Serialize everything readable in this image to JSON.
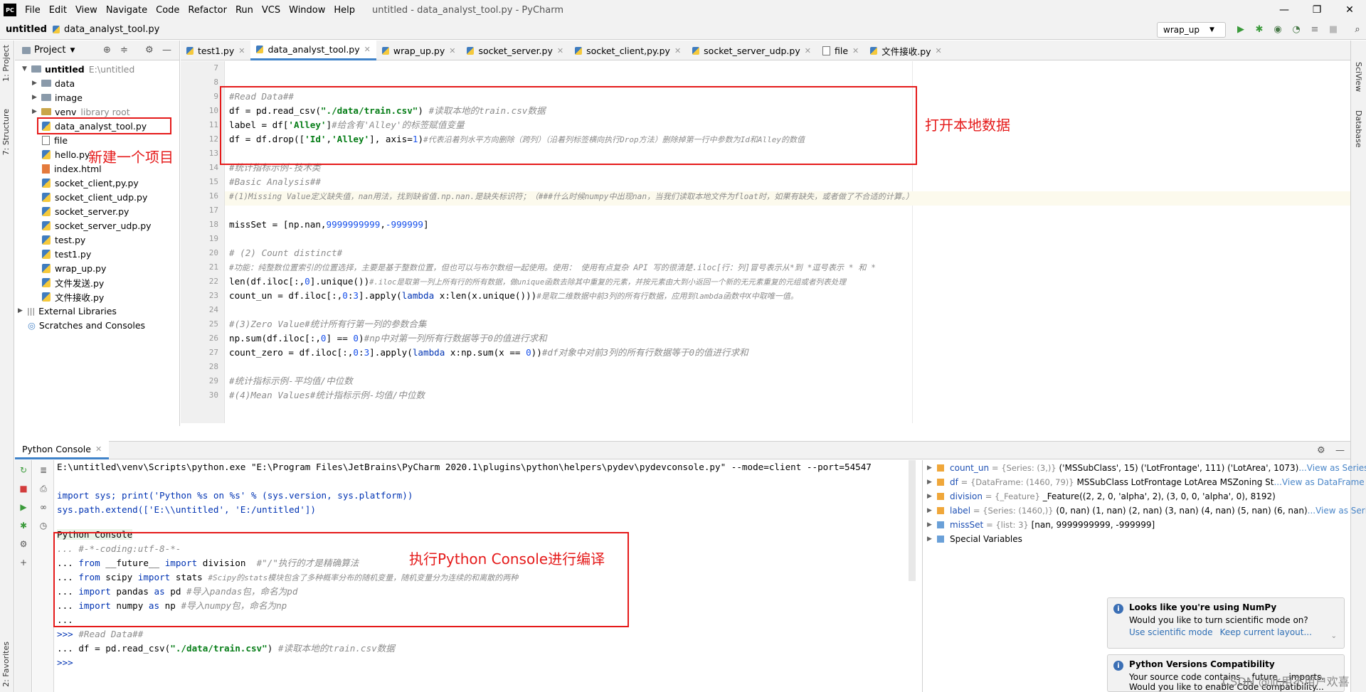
{
  "window": {
    "title": "untitled - data_analyst_tool.py - PyCharm",
    "logo": "PC"
  },
  "menu": [
    "File",
    "Edit",
    "View",
    "Navigate",
    "Code",
    "Refactor",
    "Run",
    "VCS",
    "Window",
    "Help"
  ],
  "window_buttons": [
    "—",
    "❐",
    "✕"
  ],
  "breadcrumb": [
    "untitled",
    "data_analyst_tool.py"
  ],
  "run_config": "wrap_up",
  "project": {
    "header": "Project",
    "root": "untitled",
    "root_path": "E:\\untitled",
    "items": [
      {
        "label": "data",
        "kind": "folder",
        "extra": ""
      },
      {
        "label": "image",
        "kind": "folder",
        "extra": ""
      },
      {
        "label": "venv",
        "kind": "folder",
        "extra": "library root"
      },
      {
        "label": "data_analyst_tool.py",
        "kind": "py",
        "extra": ""
      },
      {
        "label": "file",
        "kind": "file",
        "extra": ""
      },
      {
        "label": "hello.py",
        "kind": "py",
        "extra": ""
      },
      {
        "label": "index.html",
        "kind": "html",
        "extra": ""
      },
      {
        "label": "socket_client,py.py",
        "kind": "py",
        "extra": ""
      },
      {
        "label": "socket_client_udp.py",
        "kind": "py",
        "extra": ""
      },
      {
        "label": "socket_server.py",
        "kind": "py",
        "extra": ""
      },
      {
        "label": "socket_server_udp.py",
        "kind": "py",
        "extra": ""
      },
      {
        "label": "test.py",
        "kind": "py",
        "extra": ""
      },
      {
        "label": "test1.py",
        "kind": "py",
        "extra": ""
      },
      {
        "label": "wrap_up.py",
        "kind": "py",
        "extra": ""
      },
      {
        "label": "文件发送.py",
        "kind": "py",
        "extra": ""
      },
      {
        "label": "文件接收.py",
        "kind": "py",
        "extra": ""
      }
    ],
    "external": "External Libraries",
    "scratches": "Scratches and Consoles"
  },
  "side_tabs": {
    "left": [
      "1: Project",
      "7: Structure",
      "2: Favorites"
    ],
    "right": [
      "SciView",
      "Database"
    ]
  },
  "tabs": [
    "test1.py",
    "data_analyst_tool.py",
    "wrap_up.py",
    "socket_server.py",
    "socket_client,py.py",
    "socket_server_udp.py",
    "file",
    "文件接收.py"
  ],
  "editor": {
    "line_numbers": [
      "7",
      "8",
      "9",
      "10",
      "11",
      "12",
      "13",
      "14",
      "15",
      "16",
      "17",
      "18",
      "19",
      "20",
      "21",
      "22",
      "23",
      "24",
      "25",
      "26",
      "27",
      "28",
      "29",
      "30"
    ],
    "l9": "#Read Data##",
    "l10a": "df = pd.read_csv(",
    "l10b": "\"./data/train.csv\"",
    "l10c": ") ",
    "l10d": "#读取本地的train.csv数据",
    "l11a": "label = df[",
    "l11b": "'Alley'",
    "l11c": "]",
    "l11d": "#给含有'Alley'的标签赋值变量",
    "l12a": "df = df.drop([",
    "l12b": "'Id'",
    "l12c": ",",
    "l12d": "'Alley'",
    "l12e": "], axis=",
    "l12f": "1",
    "l12g": ")",
    "l12h": "#代表沿着列水平方向删除（跨列）（沿着列标签横向执行Drop方法）删除掉第一行中参数为Id和Alley的数值",
    "l14": "#统计指标示例-技术类",
    "l15": "#Basic Analysis##",
    "l16": "#(1)Missing Value定义缺失值，nan用法，找到缺省值.np.nan.是缺失标识符；（###什么时候numpy中出现nan，当我们读取本地文件为float时，如果有缺失，或者做了不合适的计算。）",
    "l18a": "missSet = [np.nan,",
    "l18b": "9999999999",
    "l18c": ",",
    "l18d": "-999999",
    "l18e": "]",
    "l20": "# (2) Count distinct#",
    "l21": "#功能：纯整数位置索引的位置选择，主要是基于整数位置，但也可以与布尔数组一起使用。使用： 使用有点复杂 API 写的很清楚.iloc[行：列]冒号表示从*到 *逗号表示 * 和 *",
    "l22a": "len(df.iloc[:,",
    "l22b": "0",
    "l22c": "].unique())",
    "l22d": "#.iloc是取第一列上所有行的所有数据，做unique函数去除其中重复的元素，并按元素由大到小返回一个新的无元素重复的元组或者列表处理",
    "l23a": "count_un = df.iloc[:,",
    "l23b": "0",
    "l23c": ":",
    "l23d": "3",
    "l23e": "].apply(",
    "l23f": "lambda",
    "l23g": " x:len(x.unique()))",
    "l23h": "#是取二维数据中前3列的所有行数据，应用到lambda函数中X中取唯一值。",
    "l25": "#(3)Zero Value#统计所有行第一列的参数合集",
    "l26a": "np.sum(df.iloc[:,",
    "l26b": "0",
    "l26c": "] == ",
    "l26d": "0",
    "l26e": ")",
    "l26f": "#np中对第一列所有行数据等于0的值进行求和",
    "l27a": "count_zero = df.iloc[:,",
    "l27b": "0",
    "l27c": ":",
    "l27d": "3",
    "l27e": "].apply(",
    "l27f": "lambda",
    "l27g": " x:np.sum(x == ",
    "l27h": "0",
    "l27i": "))",
    "l27j": "#df对象中对前3列的所有行数据等于0的值进行求和",
    "l29": "#统计指标示例-平均值/中位数",
    "l30": "#(4)Mean Values#统计指标示例-均值/中位数"
  },
  "annotations": {
    "open_local": "打开本地数据",
    "new_project": "新建一个项目",
    "run_console": "执行Python Console进行编译"
  },
  "console": {
    "tab": "Python Console",
    "cmd": "E:\\untitled\\venv\\Scripts\\python.exe \"E:\\Program Files\\JetBrains\\PyCharm 2020.1\\plugins\\python\\helpers\\pydev\\pydevconsole.py\" --mode=client --port=54547",
    "imp1": "import sys; print('Python %s on %s' % (sys.version, sys.platform))",
    "imp2": "sys.path.extend(['E:\\\\untitled', 'E:/untitled'])",
    "label": "Python Console",
    "c1": "... #-*-coding:utf-8-*-",
    "c2a": "... ",
    "c2b": "from",
    "c2c": " __future__ ",
    "c2d": "import",
    "c2e": " division  ",
    "c2f": "#\"/\"执行的才是精确算法",
    "c3a": "... ",
    "c3b": "from",
    "c3c": " scipy ",
    "c3d": "import",
    "c3e": " stats ",
    "c3f": "#Scipy的stats模块包含了多种概率分布的随机变量，随机变量分为连续的和离散的两种",
    "c4a": "... ",
    "c4b": "import",
    "c4c": " pandas ",
    "c4d": "as",
    "c4e": " pd ",
    "c4f": "#导入pandas包，命名为pd",
    "c5a": "... ",
    "c5b": "import",
    "c5c": " numpy ",
    "c5d": "as",
    "c5e": " np ",
    "c5f": "#导入numpy包，命名为np",
    "c6": "...",
    "c7a": ">>> ",
    "c7b": "#Read Data##",
    "c8a": "... df = pd.read_csv(",
    "c8b": "\"./data/train.csv\"",
    "c8c": ") ",
    "c8d": "#读取本地的train.csv数据",
    "c9": ">>>"
  },
  "variables": [
    {
      "name": "count_un",
      "meta": "= {Series: (3,)}",
      "value": "('MSSubClass', 15) ('LotFrontage', 111) ('LotArea', 1073)",
      "link": "...View as Series"
    },
    {
      "name": "df",
      "meta": "= {DataFrame: (1460, 79)}",
      "value": "MSSubClass LotFrontage LotArea MSZoning St",
      "link": "...View as DataFrame"
    },
    {
      "name": "division",
      "meta": "= {_Feature}",
      "value": "_Feature((2, 2, 0, 'alpha', 2), (3, 0, 0, 'alpha', 0), 8192)",
      "link": ""
    },
    {
      "name": "label",
      "meta": "= {Series: (1460,)}",
      "value": "(0, nan) (1, nan) (2, nan) (3, nan) (4, nan) (5, nan) (6, nan)",
      "link": "...View as Series"
    },
    {
      "name": "missSet",
      "meta": "= {list: 3}",
      "value": "[nan, 9999999999, -999999]",
      "link": ""
    },
    {
      "name": "Special Variables",
      "meta": "",
      "value": "",
      "link": ""
    }
  ],
  "notifications": [
    {
      "title": "Looks like you're using NumPy",
      "body": "Would you like to turn scientific mode on?",
      "link1": "Use scientific mode",
      "link2": "Keep current layout..."
    },
    {
      "title": "Python Versions Compatibility",
      "body": "Your source code contains __future__ imports.",
      "body2": "Would you like to enable Code compatibility..."
    }
  ],
  "watermark": "CSDN @此用不用户欢喜"
}
